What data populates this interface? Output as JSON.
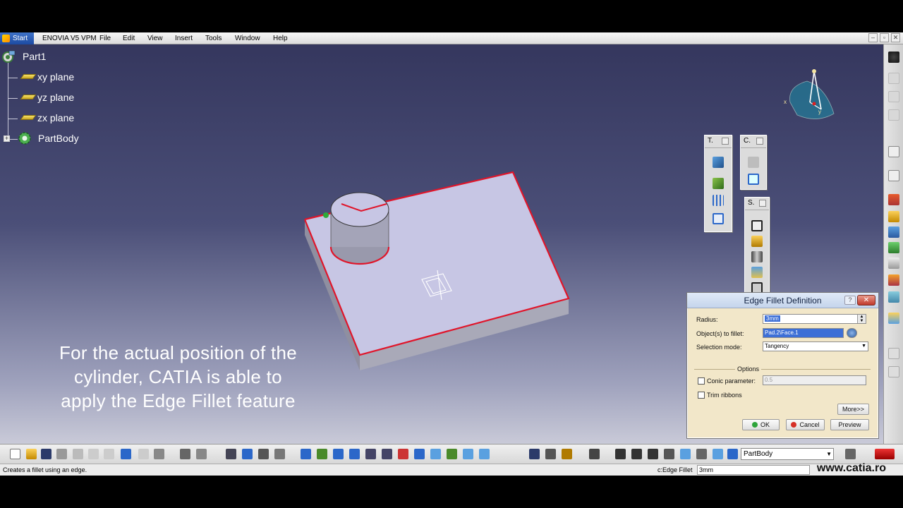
{
  "menubar": {
    "start": "Start",
    "items": [
      "ENOVIA V5 VPM",
      "File",
      "Edit",
      "View",
      "Insert",
      "Tools",
      "Window",
      "Help"
    ]
  },
  "tree": {
    "root": "Part1",
    "items": [
      "xy plane",
      "yz plane",
      "zx plane",
      "PartBody"
    ]
  },
  "overlay": {
    "line1": "For the actual position of the",
    "line2": "cylinder, CATIA is able to",
    "line3": "apply the Edge Fillet feature"
  },
  "toolbars": {
    "t": "T.",
    "c": "C.",
    "s": "S."
  },
  "compass": {
    "x": "x",
    "y": "y"
  },
  "dialog": {
    "title": "Edge Fillet Definition",
    "help": "?",
    "radius_label": "Radius:",
    "radius_value": "3mm",
    "objects_label": "Object(s) to fillet:",
    "objects_value": "Pad.2\\Face.1",
    "selection_label": "Selection mode:",
    "selection_value": "Tangency",
    "options_label": "Options",
    "conic_label": "Conic parameter:",
    "conic_value": "0.5",
    "trim_label": "Trim ribbons",
    "more_button": "More>>",
    "ok_button": "OK",
    "cancel_button": "Cancel",
    "preview_button": "Preview"
  },
  "bottom_toolbar": {
    "body_select": "PartBody"
  },
  "status": {
    "message": "Creates a fillet using an edge.",
    "command_label": "c:Edge Fillet",
    "command_value": "3mm",
    "watermark": "www.catia.ro"
  },
  "colors": {
    "viewport_top": "#35375e",
    "viewport_bottom": "#c9cad8",
    "solid_top": "#c7c6e4",
    "highlight_edge": "#e0152a",
    "dialog_bg": "#f2e7c9"
  }
}
